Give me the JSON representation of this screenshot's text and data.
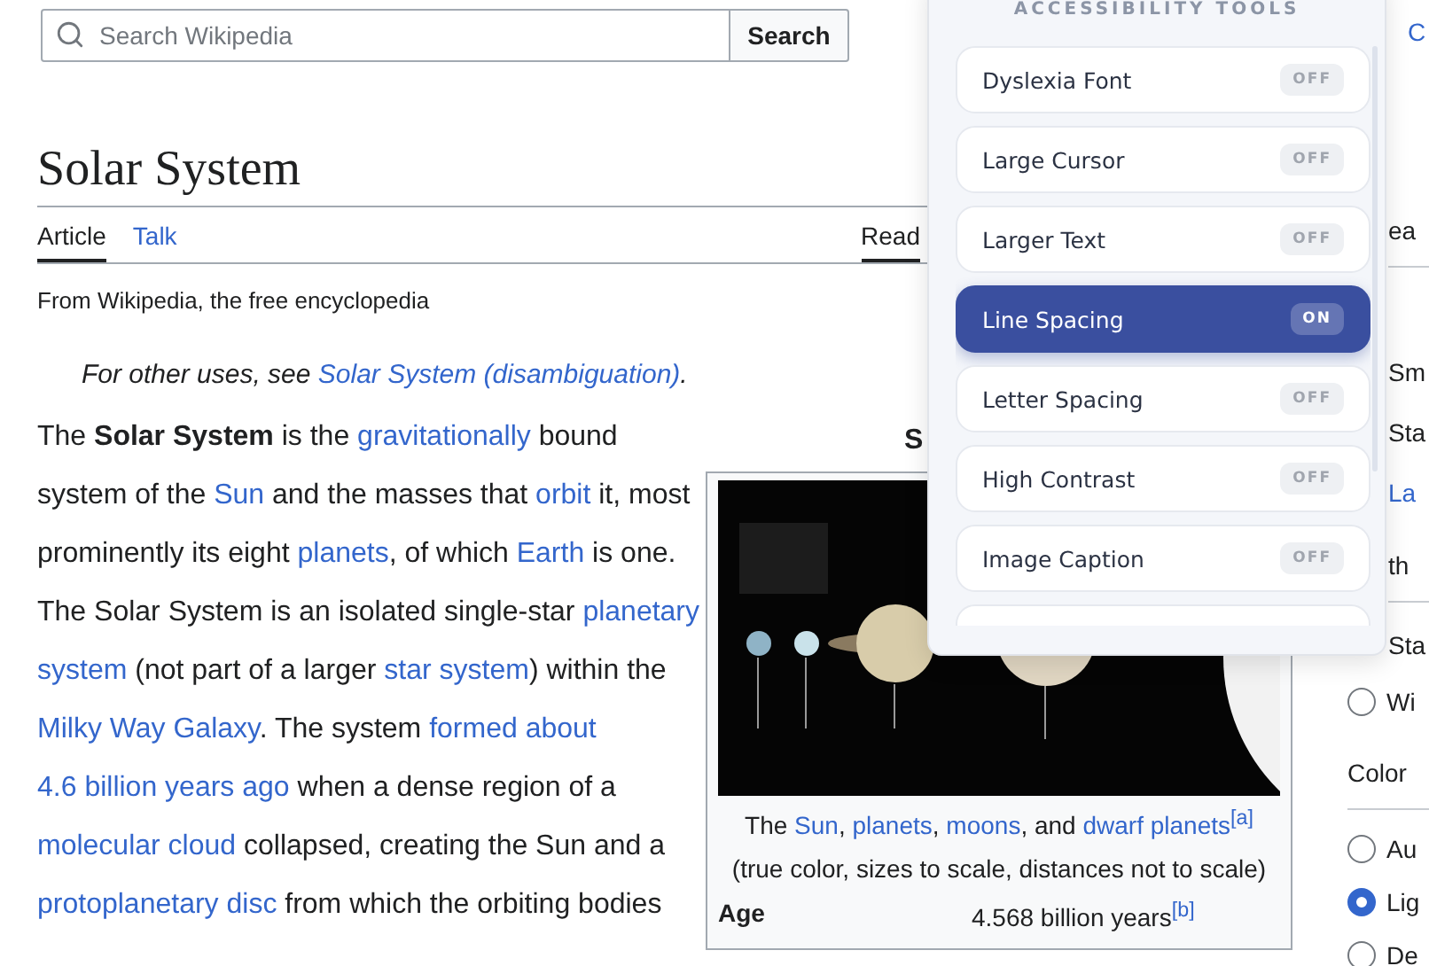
{
  "search": {
    "placeholder": "Search Wikipedia",
    "button": "Search"
  },
  "article": {
    "title": "Solar System",
    "tabs_left": [
      {
        "label": "Article",
        "selected": true
      },
      {
        "label": "Talk",
        "selected": false
      }
    ],
    "tabs_right": [
      {
        "label": "Read",
        "selected": true
      }
    ],
    "tagline": "From Wikipedia, the free encyclopedia",
    "hatnote": [
      {
        "kind": "plain",
        "text": "For other uses, see "
      },
      {
        "kind": "link",
        "text": "Solar System (disambiguation)"
      },
      {
        "kind": "plain",
        "text": "."
      }
    ],
    "paragraph": [
      {
        "kind": "plain",
        "text": "The "
      },
      {
        "kind": "bold",
        "text": "Solar System"
      },
      {
        "kind": "plain",
        "text": " is the "
      },
      {
        "kind": "link",
        "text": "gravitationally"
      },
      {
        "kind": "plain",
        "text": " bound system of the "
      },
      {
        "kind": "link",
        "text": "Sun"
      },
      {
        "kind": "plain",
        "text": " and the masses that "
      },
      {
        "kind": "link",
        "text": "orbit"
      },
      {
        "kind": "plain",
        "text": " it, most prominently its eight "
      },
      {
        "kind": "link",
        "text": "planets"
      },
      {
        "kind": "plain",
        "text": ", of which "
      },
      {
        "kind": "link",
        "text": "Earth"
      },
      {
        "kind": "plain",
        "text": " is one. The Solar System is an isolated single-star "
      },
      {
        "kind": "link",
        "text": "planetary "
      },
      {
        "kind": "link",
        "text": "system"
      },
      {
        "kind": "plain",
        "text": " (not part of a larger "
      },
      {
        "kind": "link",
        "text": "star system"
      },
      {
        "kind": "plain",
        "text": ") within the "
      },
      {
        "kind": "link",
        "text": "Milky Way Galaxy"
      },
      {
        "kind": "plain",
        "text": ". The system "
      },
      {
        "kind": "link",
        "text": "formed about "
      },
      {
        "kind": "link",
        "text": "4.6 billion years ago"
      },
      {
        "kind": "plain",
        "text": " when a dense region of a "
      },
      {
        "kind": "link",
        "text": "molecular cloud"
      },
      {
        "kind": "plain",
        "text": " collapsed, creating the Sun and a "
      },
      {
        "kind": "link",
        "text": "protoplanetary disc"
      },
      {
        "kind": "plain",
        "text": " from which the orbiting bodies"
      }
    ]
  },
  "infobox": {
    "title": "S",
    "image": {
      "kind": "picture"
    },
    "caption": [
      [
        {
          "kind": "plain",
          "text": "The "
        },
        {
          "kind": "link",
          "text": "Sun"
        },
        {
          "kind": "plain",
          "text": ", "
        },
        {
          "kind": "link",
          "text": "planets"
        },
        {
          "kind": "plain",
          "text": ", "
        },
        {
          "kind": "link",
          "text": "moons"
        },
        {
          "kind": "plain",
          "text": ", and "
        },
        {
          "kind": "link",
          "text": "dwarf planets"
        },
        {
          "kind": "sup",
          "text": "[a]"
        }
      ],
      [
        {
          "kind": "plain",
          "text": "(true color, sizes to scale, distances not to scale)"
        }
      ]
    ],
    "rows": [
      {
        "label": "Age",
        "value": [
          {
            "kind": "plain",
            "text": "4.568 billion years"
          },
          {
            "kind": "sup",
            "text": "[b]"
          }
        ]
      }
    ]
  },
  "accessibility_panel": {
    "title": "ACCESSIBILITY TOOLS",
    "tools": [
      {
        "label": "Dyslexia Font",
        "status": "OFF",
        "on": false
      },
      {
        "label": "Large Cursor",
        "status": "OFF",
        "on": false
      },
      {
        "label": "Larger Text",
        "status": "OFF",
        "on": false
      },
      {
        "label": "Line Spacing",
        "status": "ON",
        "on": true
      },
      {
        "label": "Letter Spacing",
        "status": "OFF",
        "on": false
      },
      {
        "label": "High Contrast",
        "status": "OFF",
        "on": false
      },
      {
        "label": "Image Caption",
        "status": "OFF",
        "on": false
      }
    ]
  },
  "sidebar": [
    {
      "text": "C",
      "kind": "link"
    },
    {
      "text": "ea",
      "kind": "heading"
    },
    {
      "text": "Sm",
      "kind": "option"
    },
    {
      "text": "Sta",
      "kind": "option"
    },
    {
      "text": "La",
      "kind": "link_option"
    },
    {
      "text": "th",
      "kind": "heading"
    },
    {
      "text": "Sta",
      "kind": "option"
    },
    {
      "text": "Wi",
      "kind": "radio",
      "selected": false
    },
    {
      "text": "Color",
      "kind": "section"
    },
    {
      "text": "Au",
      "kind": "radio",
      "selected": false
    },
    {
      "text": "Lig",
      "kind": "radio",
      "selected": true
    },
    {
      "text": "De",
      "kind": "radio",
      "selected": false
    }
  ]
}
